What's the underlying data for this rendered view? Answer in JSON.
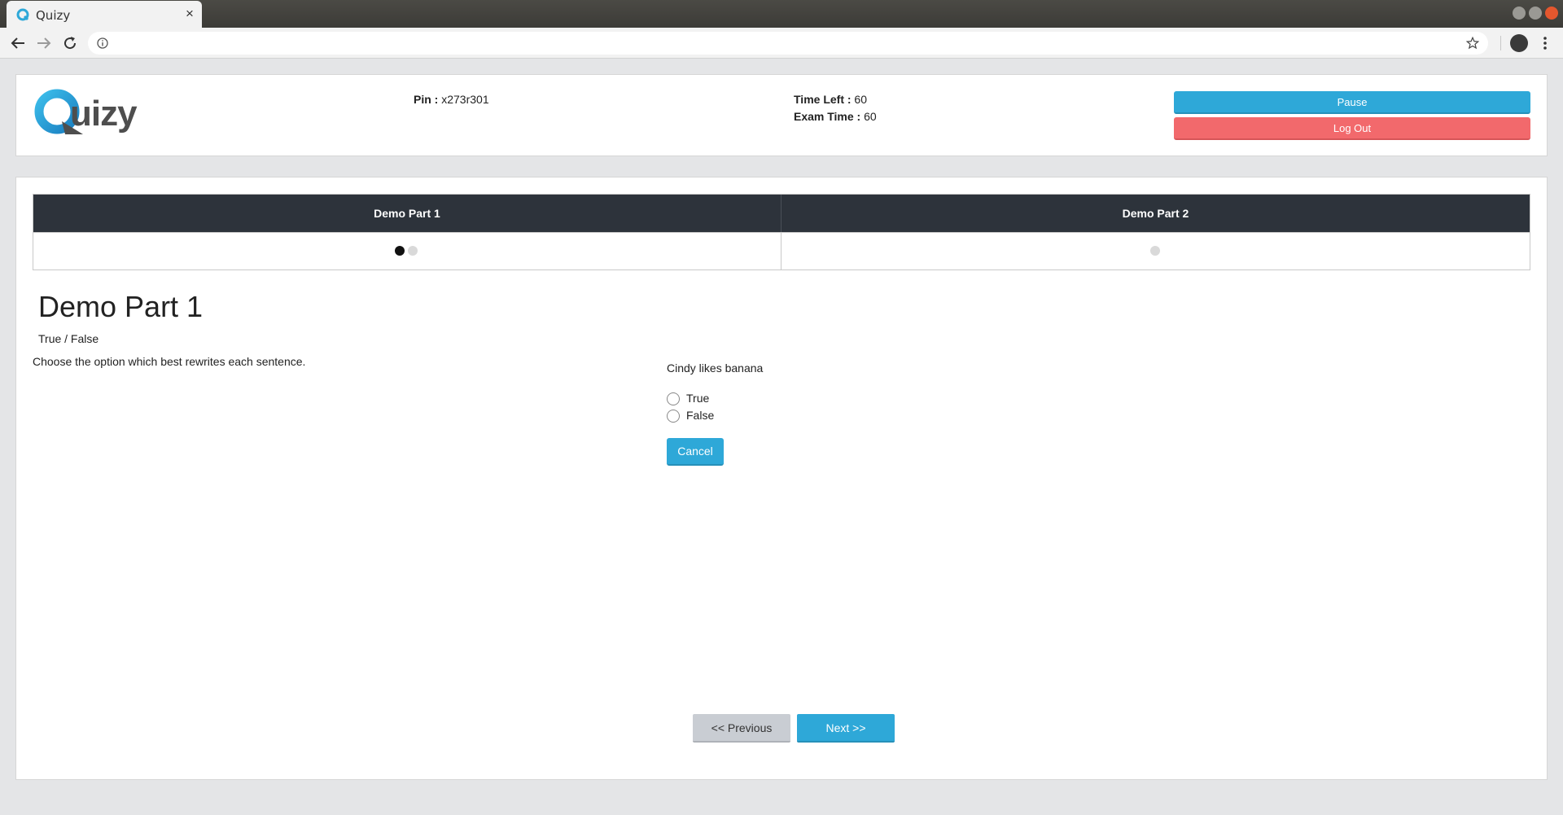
{
  "browser": {
    "tab_title": "Quizy",
    "tab_close": "×",
    "url": "",
    "icons": [
      "quizy-favicon-icon",
      "back-icon",
      "forward-icon",
      "reload-icon",
      "info-icon",
      "star-icon",
      "profile-icon",
      "menu-icon"
    ]
  },
  "header": {
    "logo_text": "uizy",
    "pin_label": "Pin :",
    "pin_value": "x273r301",
    "time_left_label": "Time Left :",
    "time_left_value": "60",
    "exam_time_label": "Exam Time :",
    "exam_time_value": "60",
    "pause_label": "Pause",
    "logout_label": "Log Out"
  },
  "parts": [
    {
      "name": "Demo Part 1",
      "dots": [
        "active",
        "idle"
      ]
    },
    {
      "name": "Demo Part 2",
      "dots": [
        "idle"
      ]
    }
  ],
  "section": {
    "title": "Demo Part 1",
    "subtitle": "True / False",
    "instructions": "Choose the option which best rewrites each sentence."
  },
  "question": {
    "text": "Cindy likes banana",
    "options": [
      "True",
      "False"
    ],
    "cancel_label": "Cancel"
  },
  "navigation": {
    "previous_label": "<< Previous",
    "next_label": "Next >>"
  },
  "colors": {
    "primary": "#2ea8d8",
    "danger": "#f2696c",
    "table_header": "#2d333b",
    "secondary": "#c9cdd3"
  }
}
